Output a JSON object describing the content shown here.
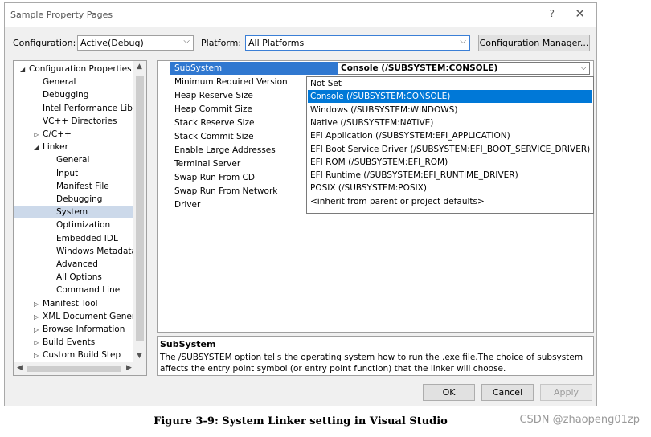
{
  "window": {
    "title": "Sample Property Pages",
    "help_glyph": "?",
    "close_glyph": "✕"
  },
  "toolbar": {
    "configuration_label": "Configuration:",
    "configuration_value": "Active(Debug)",
    "platform_label": "Platform:",
    "platform_value": "All Platforms",
    "config_manager_label": "Configuration Manager..."
  },
  "tree": {
    "items": [
      {
        "label": "Configuration Properties",
        "expander": "◢"
      },
      {
        "label": "General",
        "expander": ""
      },
      {
        "label": "Debugging",
        "expander": ""
      },
      {
        "label": "Intel Performance Libraries",
        "expander": ""
      },
      {
        "label": "VC++ Directories",
        "expander": ""
      },
      {
        "label": "C/C++",
        "expander": "▷"
      },
      {
        "label": "Linker",
        "expander": "◢"
      },
      {
        "label": "General",
        "expander": ""
      },
      {
        "label": "Input",
        "expander": ""
      },
      {
        "label": "Manifest File",
        "expander": ""
      },
      {
        "label": "Debugging",
        "expander": ""
      },
      {
        "label": "System",
        "expander": ""
      },
      {
        "label": "Optimization",
        "expander": ""
      },
      {
        "label": "Embedded IDL",
        "expander": ""
      },
      {
        "label": "Windows Metadata",
        "expander": ""
      },
      {
        "label": "Advanced",
        "expander": ""
      },
      {
        "label": "All Options",
        "expander": ""
      },
      {
        "label": "Command Line",
        "expander": ""
      },
      {
        "label": "Manifest Tool",
        "expander": "▷"
      },
      {
        "label": "XML Document Generator",
        "expander": "▷"
      },
      {
        "label": "Browse Information",
        "expander": "▷"
      },
      {
        "label": "Build Events",
        "expander": "▷"
      },
      {
        "label": "Custom Build Step",
        "expander": "▷"
      }
    ],
    "selected_index": 11
  },
  "grid": {
    "subsystem_name": "SubSystem",
    "subsystem_value": "Console (/SUBSYSTEM:CONSOLE)",
    "properties": [
      "Minimum Required Version",
      "Heap Reserve Size",
      "Heap Commit Size",
      "Stack Reserve Size",
      "Stack Commit Size",
      "Enable Large Addresses",
      "Terminal Server",
      "Swap Run From CD",
      "Swap Run From Network",
      "Driver"
    ]
  },
  "dropdown": {
    "options": [
      "Not Set",
      "Console (/SUBSYSTEM:CONSOLE)",
      "Windows (/SUBSYSTEM:WINDOWS)",
      "Native (/SUBSYSTEM:NATIVE)",
      "EFI Application (/SUBSYSTEM:EFI_APPLICATION)",
      "EFI Boot Service Driver (/SUBSYSTEM:EFI_BOOT_SERVICE_DRIVER)",
      "EFI ROM (/SUBSYSTEM:EFI_ROM)",
      "EFI Runtime (/SUBSYSTEM:EFI_RUNTIME_DRIVER)",
      "POSIX (/SUBSYSTEM:POSIX)",
      "<inherit from parent or project defaults>"
    ],
    "selected_index": 1
  },
  "description": {
    "title": "SubSystem",
    "text": "The /SUBSYSTEM option tells the operating system how to run the .exe file.The choice of subsystem affects the entry point symbol (or entry point function) that the linker will choose."
  },
  "buttons": {
    "ok": "OK",
    "cancel": "Cancel",
    "apply": "Apply"
  },
  "caption": "Figure 3-9: System Linker setting in Visual Studio",
  "watermark": "CSDN @zhaopeng01zp"
}
